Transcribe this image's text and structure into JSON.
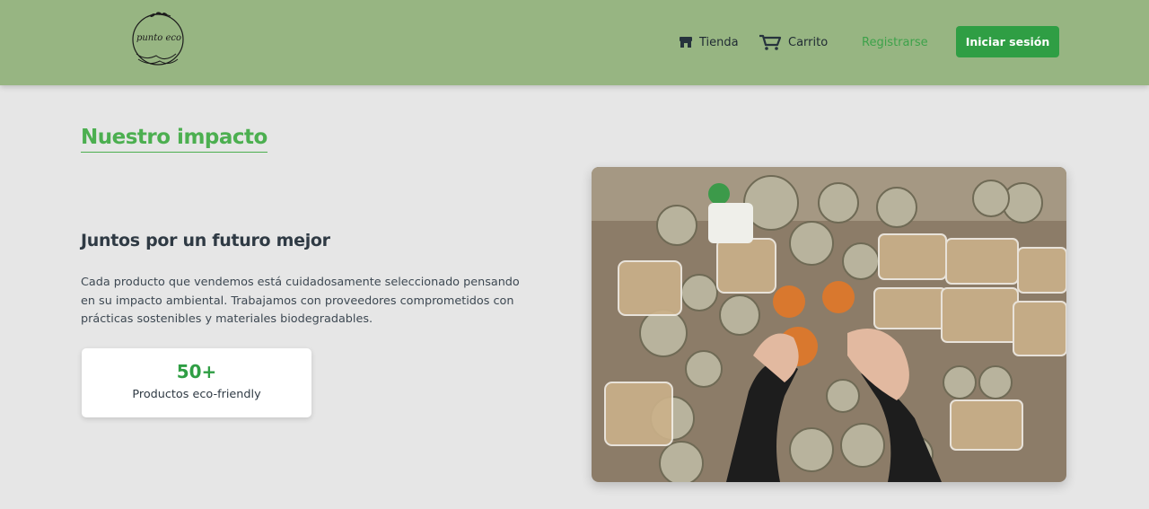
{
  "header": {
    "logo_text": "punto eco",
    "nav": {
      "store_label": "Tienda",
      "cart_label": "Carrito",
      "register_label": "Registrarse",
      "login_label": "Iniciar sesión"
    },
    "colors": {
      "bar": "#97b582",
      "accent": "#2f9e44",
      "register_link": "#3da24a"
    }
  },
  "main": {
    "section_title": "Nuestro impacto",
    "subtitle": "Juntos por un futuro mejor",
    "description": "Cada producto que vendemos está cuidadosamente seleccionado pensando en su impacto ambiental. Trabajamos con proveedores comprometidos con prácticas sostenibles y materiales biodegradables.",
    "stat": {
      "value": "50+",
      "label": "Productos eco-friendly"
    },
    "image": {
      "icon": "pantry-jars-photo"
    }
  },
  "icons": {
    "store": "store-icon",
    "cart": "cart-icon",
    "logo": "leaf-wreath-logo"
  }
}
